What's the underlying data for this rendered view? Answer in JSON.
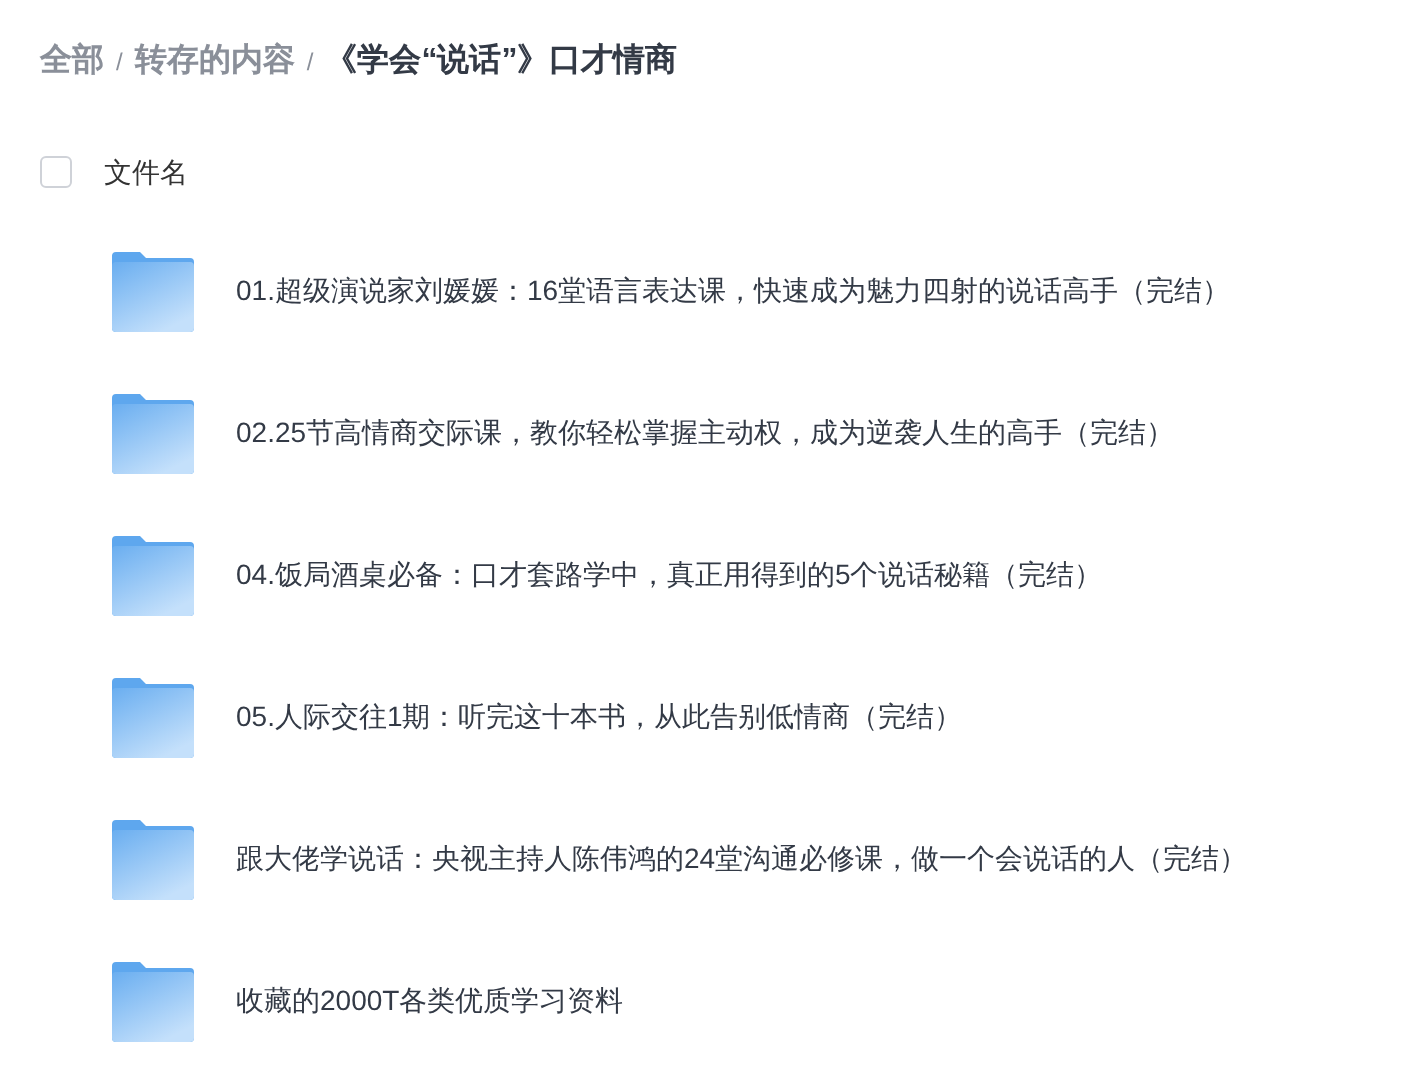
{
  "breadcrumb": [
    {
      "kind": "link",
      "label": "全部"
    },
    {
      "kind": "separator",
      "label": "/"
    },
    {
      "kind": "link",
      "label": "转存的内容"
    },
    {
      "kind": "separator",
      "label": "/"
    },
    {
      "kind": "current",
      "label": "《学会“说话”》口才情商"
    }
  ],
  "header": {
    "checked": false,
    "label": "文件名"
  },
  "files": [
    {
      "name": "01.超级演说家刘媛媛：16堂语言表达课，快速成为魅力四射的说话高手（完结）"
    },
    {
      "name": "02.25节高情商交际课，教你轻松掌握主动权，成为逆袭人生的高手（完结）"
    },
    {
      "name": "04.饭局酒桌必备：口才套路学中，真正用得到的5个说话秘籍（完结）"
    },
    {
      "name": "05.人际交往1期：听完这十本书，从此告别低情商（完结）"
    },
    {
      "name": "跟大佬学说话：央视主持人陈伟鸿的24堂沟通必修课，做一个会说话的人（完结）"
    },
    {
      "name": "收藏的2000T各类优质学习资料"
    }
  ]
}
